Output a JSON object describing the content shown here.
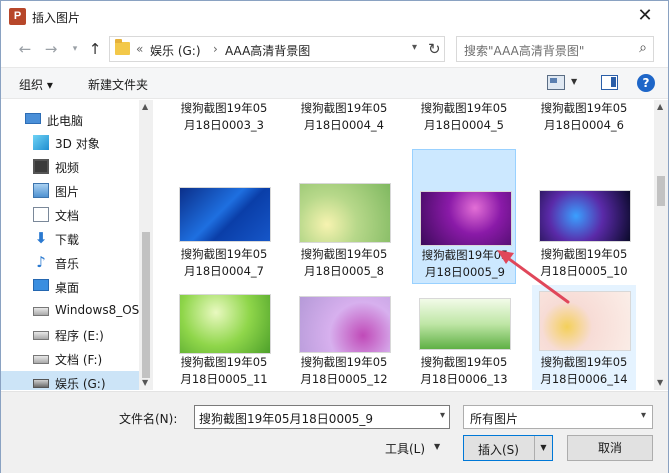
{
  "window": {
    "title": "插入图片",
    "app_icon_letter": "P"
  },
  "address": {
    "prefix": "«",
    "crumbs": [
      "娱乐 (G:)",
      "AAA高清背景图"
    ],
    "separator": "›"
  },
  "search": {
    "placeholder": "搜索\"AAA高清背景图\""
  },
  "toolbar": {
    "organize": "组织 ▾",
    "new_folder": "新建文件夹",
    "help": "?"
  },
  "sidebar": {
    "items": [
      {
        "label": "此电脑",
        "icon": "computer-icon"
      },
      {
        "label": "3D 对象",
        "icon": "3d-objects-icon"
      },
      {
        "label": "视频",
        "icon": "video-icon"
      },
      {
        "label": "图片",
        "icon": "pictures-icon"
      },
      {
        "label": "文档",
        "icon": "documents-icon"
      },
      {
        "label": "下载",
        "icon": "download-icon"
      },
      {
        "label": "音乐",
        "icon": "music-icon"
      },
      {
        "label": "桌面",
        "icon": "desktop-icon"
      },
      {
        "label": "Windows8_OS",
        "icon": "drive-icon"
      },
      {
        "label": "程序 (E:)",
        "icon": "drive-icon"
      },
      {
        "label": "文档 (F:)",
        "icon": "drive-icon"
      },
      {
        "label": "娱乐 (G:)",
        "icon": "drive-icon"
      }
    ]
  },
  "files": [
    {
      "line1": "搜狗截图19年05",
      "line2": "月18日0003_3"
    },
    {
      "line1": "搜狗截图19年05",
      "line2": "月18日0004_4"
    },
    {
      "line1": "搜狗截图19年05",
      "line2": "月18日0004_5"
    },
    {
      "line1": "搜狗截图19年05",
      "line2": "月18日0004_6"
    },
    {
      "line1": "搜狗截图19年05",
      "line2": "月18日0004_7"
    },
    {
      "line1": "搜狗截图19年05",
      "line2": "月18日0005_8"
    },
    {
      "line1": "搜狗截图19年05",
      "line2": "月18日0005_9"
    },
    {
      "line1": "搜狗截图19年05",
      "line2": "月18日0005_10"
    },
    {
      "line1": "搜狗截图19年05",
      "line2": "月18日0005_11"
    },
    {
      "line1": "搜狗截图19年05",
      "line2": "月18日0005_12"
    },
    {
      "line1": "搜狗截图19年05",
      "line2": "月18日0006_13"
    },
    {
      "line1": "搜狗截图19年05",
      "line2": "月18日0006_14"
    }
  ],
  "bottom": {
    "filename_label": "文件名(N):",
    "filename_value": "搜狗截图19年05月18日0005_9",
    "filetype_value": "所有图片",
    "tools": "工具(L)",
    "insert": "插入(S)",
    "cancel": "取消"
  },
  "colors": {
    "selection": "#cce8ff",
    "accent": "#0078d7",
    "annotation_arrow": "#e0475a"
  }
}
